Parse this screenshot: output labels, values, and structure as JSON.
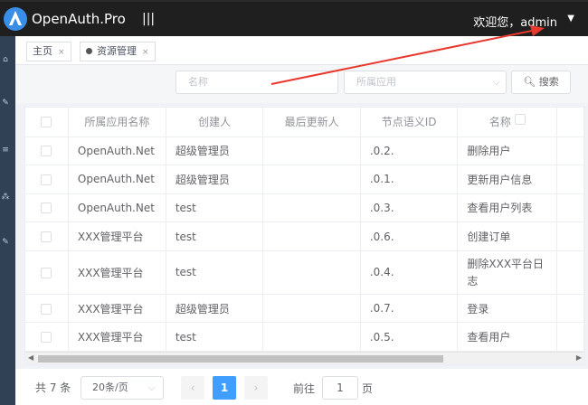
{
  "app": {
    "title": "OpenAuth.Pro",
    "menu_toggle": "|||"
  },
  "header": {
    "welcome": "欢迎您，admin",
    "caret": "▼"
  },
  "tabs": [
    {
      "label": "主页",
      "close": "×"
    },
    {
      "label": "资源管理",
      "close": "×"
    }
  ],
  "filters": {
    "name_placeholder": "名称",
    "app_placeholder": "所属应用",
    "search_label": "搜索",
    "search_icon": "🔍︎"
  },
  "table": {
    "columns": [
      "所属应用名称",
      "创建人",
      "最后更新人",
      "节点语义ID",
      "名称"
    ],
    "rows": [
      [
        "OpenAuth.Net",
        "超级管理员",
        "",
        ".0.2.",
        "删除用户"
      ],
      [
        "OpenAuth.Net",
        "超级管理员",
        "",
        ".0.1.",
        "更新用户信息"
      ],
      [
        "OpenAuth.Net",
        "test",
        "",
        ".0.3.",
        "查看用户列表"
      ],
      [
        "XXX管理平台",
        "test",
        "",
        ".0.6.",
        "创建订单"
      ],
      [
        "XXX管理平台",
        "test",
        "",
        ".0.4.",
        "删除XXX平台日志"
      ],
      [
        "XXX管理平台",
        "超级管理员",
        "",
        ".0.7.",
        "登录"
      ],
      [
        "XXX管理平台",
        "test",
        "",
        ".0.5.",
        "查看用户"
      ]
    ]
  },
  "pagination": {
    "total": "共 7 条",
    "page_size": "20条/页",
    "prev": "‹",
    "current_page": "1",
    "next": "›",
    "goto_label": "前往",
    "goto_value": "1",
    "goto_suffix": "页"
  },
  "colors": {
    "topbar": "#1f1f1f",
    "sidebar": "#304156",
    "accent": "#409eff",
    "annotation": "#e8392e"
  }
}
